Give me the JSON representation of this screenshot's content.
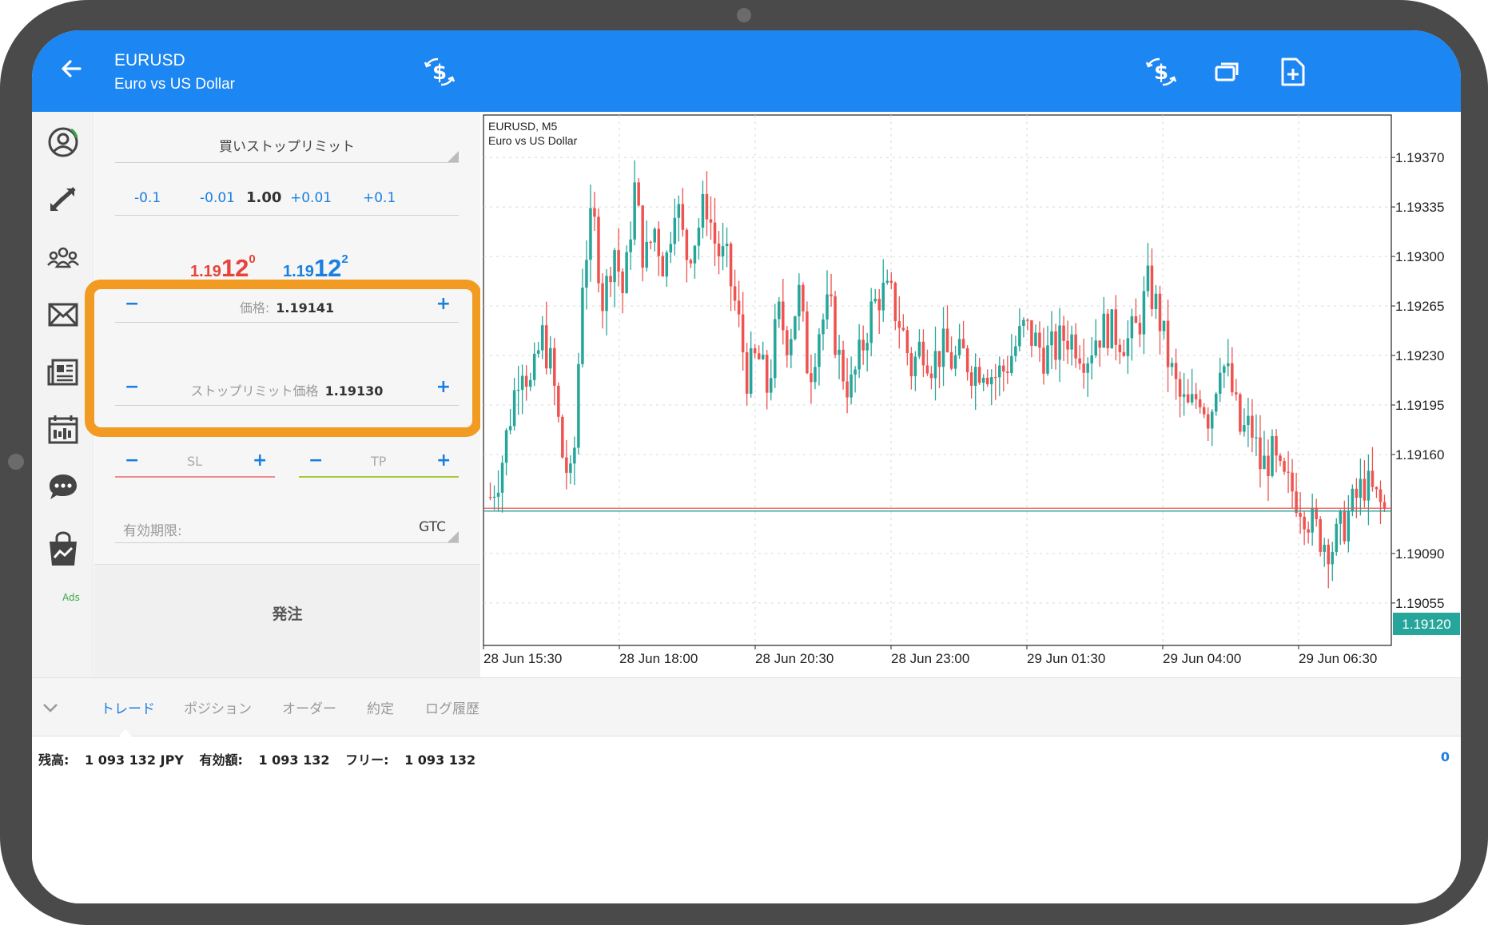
{
  "header": {
    "symbol": "EURUSD",
    "description": "Euro vs US Dollar",
    "icons": [
      "back-arrow-icon",
      "currency-exchange-icon",
      "currency-exchange-icon",
      "window-copy-icon",
      "new-document-icon"
    ]
  },
  "sidebar": {
    "items": [
      {
        "icon": "account-icon"
      },
      {
        "icon": "trade-arrows-icon"
      },
      {
        "icon": "community-icon"
      },
      {
        "icon": "mail-icon"
      },
      {
        "icon": "news-icon"
      },
      {
        "icon": "calendar-icon",
        "badge": "Ads"
      },
      {
        "icon": "chat-icon"
      },
      {
        "icon": "market-bag-icon"
      }
    ]
  },
  "order": {
    "type": "買いストップリミット",
    "volume_steps": [
      "-0.1",
      "-0.01",
      "+0.01",
      "+0.1"
    ],
    "volume": "1.00",
    "bid": {
      "prefix": "1.19",
      "big": "12",
      "sup": "0"
    },
    "ask": {
      "prefix": "1.19",
      "big": "12",
      "sup": "2"
    },
    "price_label": "価格:",
    "price_value": "1.19141",
    "stoplimit_label": "ストップリミット価格",
    "stoplimit_value": "1.19130",
    "sl_label": "SL",
    "tp_label": "TP",
    "expiry_label": "有効期限:",
    "expiry_value": "GTC",
    "place_label": "発注",
    "minus": "−",
    "plus": "+"
  },
  "chart_data": {
    "type": "candlestick",
    "title": "EURUSD, M5",
    "subtitle": "Euro vs US Dollar",
    "y_ticks": [
      "1.19370",
      "1.19335",
      "1.19300",
      "1.19265",
      "1.19230",
      "1.19195",
      "1.19160",
      "1.19090",
      "1.19055"
    ],
    "ylim": [
      1.19025,
      1.194
    ],
    "x_ticks": [
      "28 Jun 15:30",
      "28 Jun 18:00",
      "28 Jun 20:30",
      "28 Jun 23:00",
      "29 Jun 01:30",
      "29 Jun 04:00",
      "29 Jun 06:30"
    ],
    "current_price": "1.19120",
    "current_price_value": 1.1912,
    "ask_price_value": 1.19122,
    "grid": true,
    "colors": {
      "up": "#26a69a",
      "down": "#ef5350",
      "price_tag": "#26a69a",
      "ask_line": "#ef5350"
    },
    "close_path": [
      1.1913,
      1.1915,
      1.1919,
      1.1923,
      1.19205,
      1.19245,
      1.1922,
      1.1916,
      1.19135,
      1.1929,
      1.1933,
      1.19265,
      1.1931,
      1.1927,
      1.1935,
      1.19295,
      1.1932,
      1.1929,
      1.19345,
      1.193,
      1.19315,
      1.1934,
      1.19305,
      1.19295,
      1.1926,
      1.19215,
      1.1923,
      1.19205,
      1.1926,
      1.1924,
      1.19275,
      1.19215,
      1.1925,
      1.19265,
      1.19225,
      1.19205,
      1.1923,
      1.1926,
      1.19275,
      1.1927,
      1.1925,
      1.1922,
      1.1924,
      1.19225,
      1.19235,
      1.19225,
      1.1923,
      1.1922,
      1.19225,
      1.19215,
      1.1922,
      1.19235,
      1.1925,
      1.1924,
      1.1923,
      1.19235,
      1.19245,
      1.1924,
      1.1923,
      1.19245,
      1.1925,
      1.19245,
      1.1924,
      1.1925,
      1.1928,
      1.1926,
      1.19225,
      1.192,
      1.1919,
      1.19205,
      1.19185,
      1.1923,
      1.1921,
      1.19175,
      1.1918,
      1.1915,
      1.1916,
      1.1914,
      1.19135,
      1.19125,
      1.1911,
      1.191,
      1.19095,
      1.1911,
      1.19125,
      1.1914,
      1.1913,
      1.1912
    ]
  },
  "bottom": {
    "tabs": [
      "トレード",
      "ポジション",
      "オーダー",
      "約定",
      "ログ履歴"
    ],
    "active_tab": 0,
    "balance_label": "残高:",
    "balance_value": "1 093 132 JPY",
    "equity_label": "有効額:",
    "equity_value": "1 093 132",
    "free_label": "フリー:",
    "free_value": "1 093 132",
    "count": "0"
  }
}
